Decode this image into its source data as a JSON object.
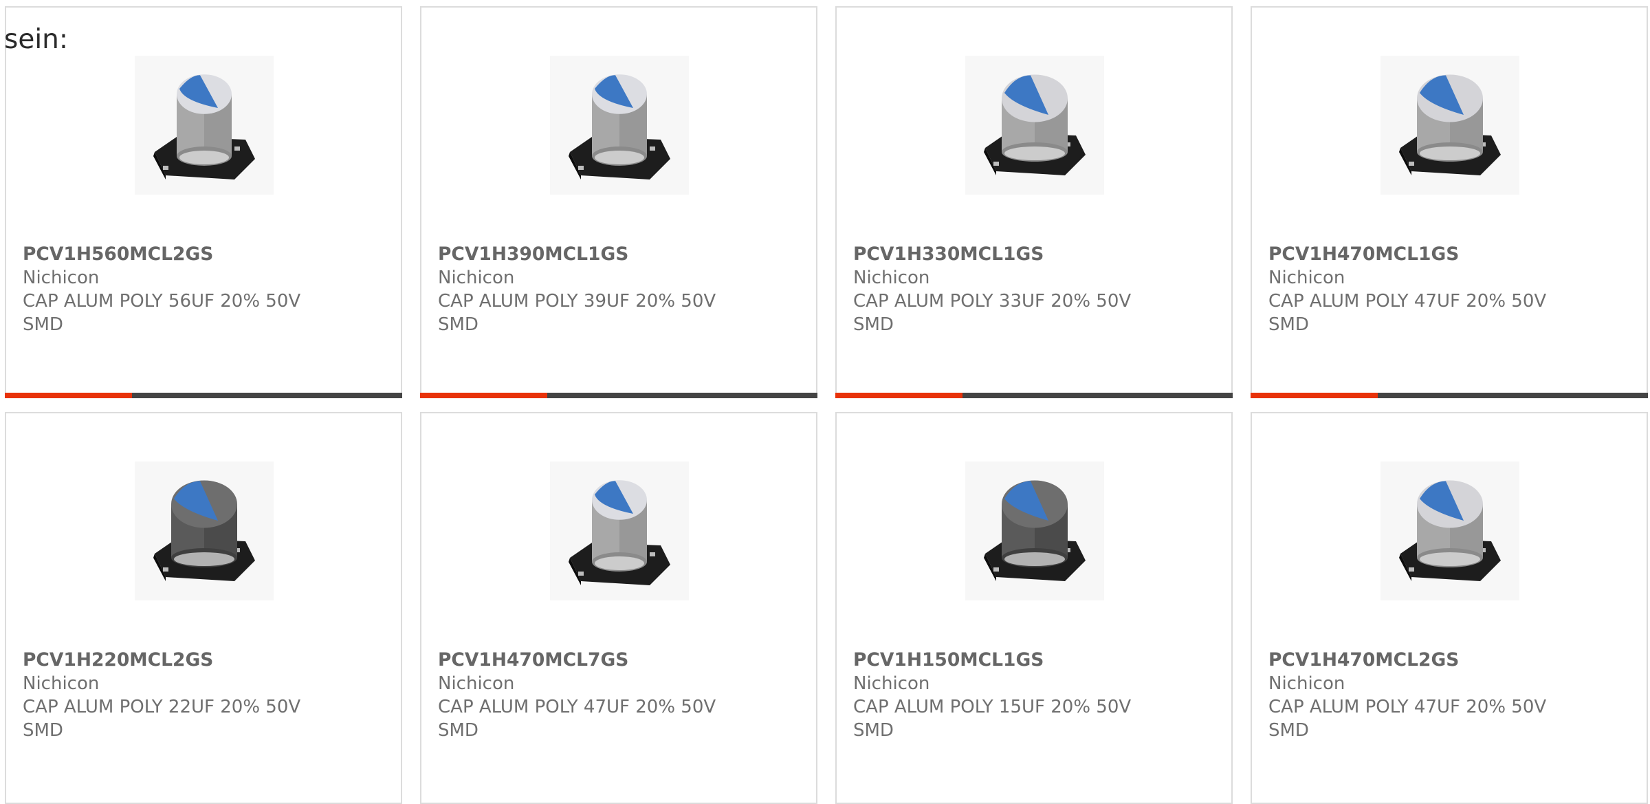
{
  "intro_text": "sein:",
  "colors": {
    "accent": "#e8320a",
    "track": "#444444",
    "border": "#dcdcdc",
    "text": "#6f6f6f"
  },
  "products": [
    {
      "part_number": "PCV1H560MCL2GS",
      "manufacturer": "Nichicon",
      "description": "CAP ALUM POLY 56UF 20% 50V SMD",
      "icon": "capacitor-light-icon",
      "progress": 0.32
    },
    {
      "part_number": "PCV1H390MCL1GS",
      "manufacturer": "Nichicon",
      "description": "CAP ALUM POLY 39UF 20% 50V SMD",
      "icon": "capacitor-light-icon",
      "progress": 0.32
    },
    {
      "part_number": "PCV1H330MCL1GS",
      "manufacturer": "Nichicon",
      "description": "CAP ALUM POLY 33UF 20% 50V SMD",
      "icon": "capacitor-wide-icon",
      "progress": 0.32
    },
    {
      "part_number": "PCV1H470MCL1GS",
      "manufacturer": "Nichicon",
      "description": "CAP ALUM POLY 47UF 20% 50V SMD",
      "icon": "capacitor-wide-icon",
      "progress": 0.32
    },
    {
      "part_number": "PCV1H220MCL2GS",
      "manufacturer": "Nichicon",
      "description": "CAP ALUM POLY 22UF 20% 50V SMD",
      "icon": "capacitor-dark-icon"
    },
    {
      "part_number": "PCV1H470MCL7GS",
      "manufacturer": "Nichicon",
      "description": "CAP ALUM POLY 47UF 20% 50V SMD",
      "icon": "capacitor-light-icon"
    },
    {
      "part_number": "PCV1H150MCL1GS",
      "manufacturer": "Nichicon",
      "description": "CAP ALUM POLY 15UF 20% 50V SMD",
      "icon": "capacitor-dark-icon"
    },
    {
      "part_number": "PCV1H470MCL2GS",
      "manufacturer": "Nichicon",
      "description": "CAP ALUM POLY 47UF 20% 50V SMD",
      "icon": "capacitor-wide-icon"
    }
  ]
}
